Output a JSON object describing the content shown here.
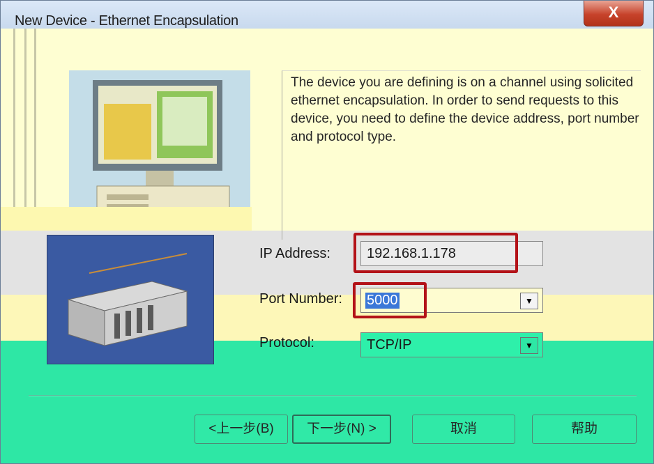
{
  "window": {
    "title": "New Device - Ethernet Encapsulation",
    "close_label": "X"
  },
  "description": "The device you are defining is on a channel using solicited ethernet encapsulation.  In order to send requests to this device, you need to define the device address, port number and protocol type.",
  "fields": {
    "ip_address": {
      "label": "IP Address:",
      "value": "192.168.1.178"
    },
    "port_number": {
      "label": "Port Number:",
      "value": "5000"
    },
    "protocol": {
      "label": "Protocol:",
      "value": "TCP/IP"
    }
  },
  "buttons": {
    "back": "<上一步(B)",
    "next": "下一步(N) >",
    "cancel": "取消",
    "help": "帮助"
  },
  "colors": {
    "highlight": "#b31218",
    "title_bar": "#c8d9ee",
    "panel": "#fefed2",
    "button_area": "#2ee7a5"
  },
  "icons": {
    "close": "close-icon",
    "dropdown": "chevron-down-icon"
  }
}
